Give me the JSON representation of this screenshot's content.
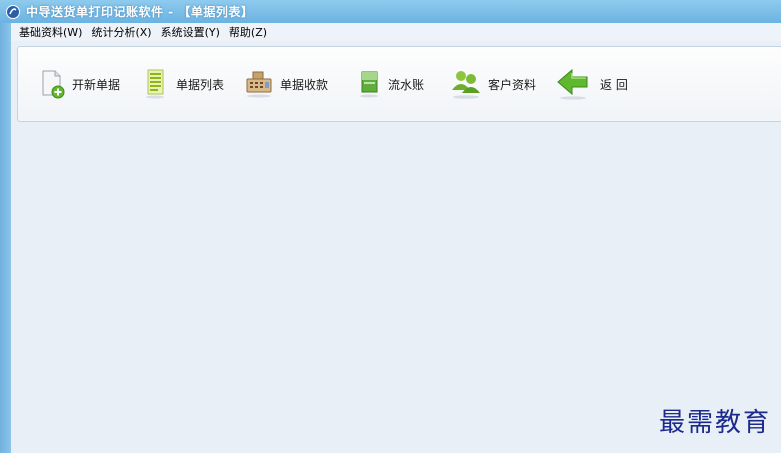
{
  "window": {
    "title": "中导送货单打印记账软件 - 【单据列表】"
  },
  "menu": [
    {
      "label": "基础资料(W)"
    },
    {
      "label": "统计分析(X)"
    },
    {
      "label": "系统设置(Y)"
    },
    {
      "label": "帮助(Z)"
    }
  ],
  "toolbar": {
    "new_doc": "开新单据",
    "doc_list": "单据列表",
    "doc_receipt": "单据收款",
    "ledger": "流水账",
    "customer": "客户资料",
    "back": "返 回"
  },
  "watermark": "最需教育",
  "colors": {
    "titlebar": "#6bb3e2",
    "background": "#e9eff7",
    "accent_green": "#5fb82e"
  }
}
